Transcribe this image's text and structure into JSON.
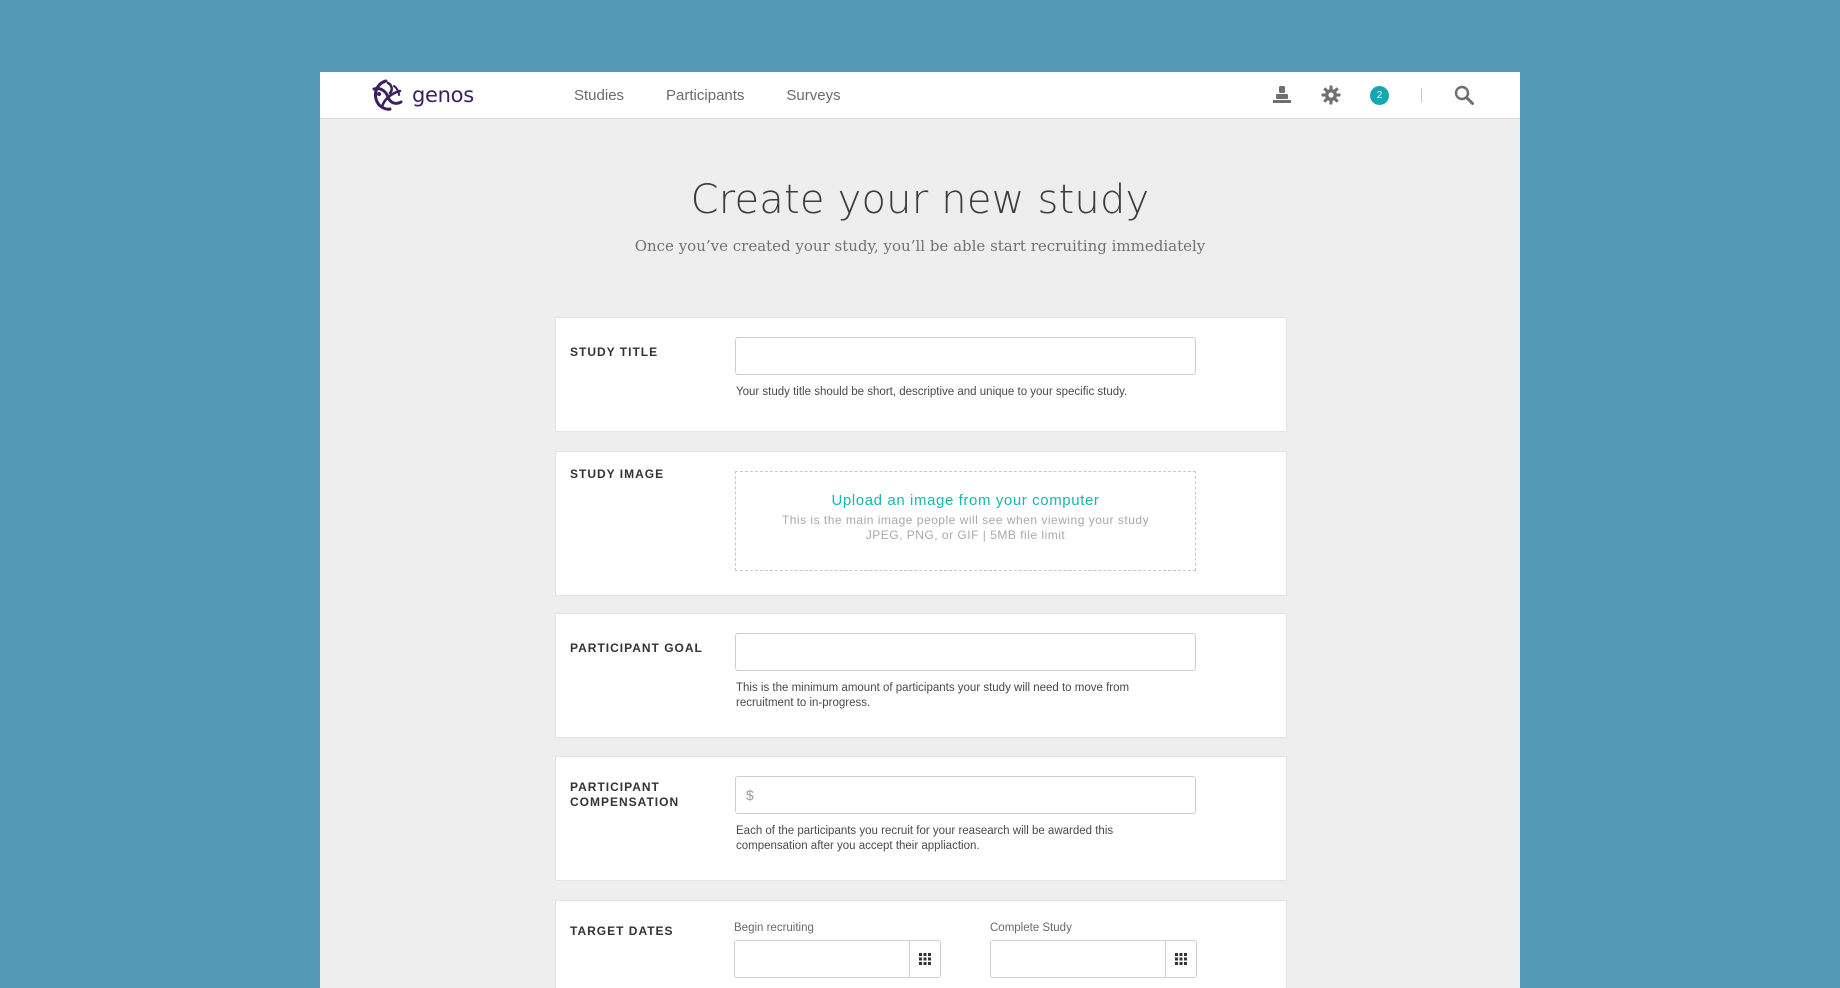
{
  "app": {
    "brand": "genos",
    "nav": [
      {
        "label": "Studies"
      },
      {
        "label": "Participants"
      },
      {
        "label": "Surveys"
      }
    ],
    "notification_count": "2",
    "icons": [
      "user-icon",
      "gear-icon",
      "notification-badge",
      "search-icon"
    ]
  },
  "hero": {
    "title": "Create your new study",
    "subtitle": "Once you’ve created your study, you’ll be able start recruiting immediately"
  },
  "form": {
    "study_title": {
      "label": "STUDY TITLE",
      "value": "",
      "help": "Your study title should be short, descriptive and unique to your specific study."
    },
    "study_image": {
      "label": "STUDY IMAGE",
      "upload_link": "Upload an image from your computer",
      "hint1": "This is the main image people will see when viewing your study",
      "hint2": "JPEG, PNG, or GIF | 5MB file limit"
    },
    "participant_goal": {
      "label": "PARTICIPANT GOAL",
      "value": "",
      "help": "This is the minimum amount of participants your study will need to move from recruitment to in-progress."
    },
    "participant_compensation": {
      "label_line1": "PARTICIPANT",
      "label_line2": "COMPENSATION",
      "placeholder": "$",
      "help": "Each of the participants you recruit for your reasearch will be awarded this compensation after you accept their appliaction."
    },
    "target_dates": {
      "label": "TARGET DATES",
      "begin_label": "Begin recruiting",
      "begin_value": "",
      "complete_label": "Complete Study",
      "complete_value": ""
    }
  },
  "colors": {
    "background": "#5499b5",
    "accent": "#18b7b3",
    "brand": "#3b1f61",
    "badge": "#14a7b3"
  }
}
